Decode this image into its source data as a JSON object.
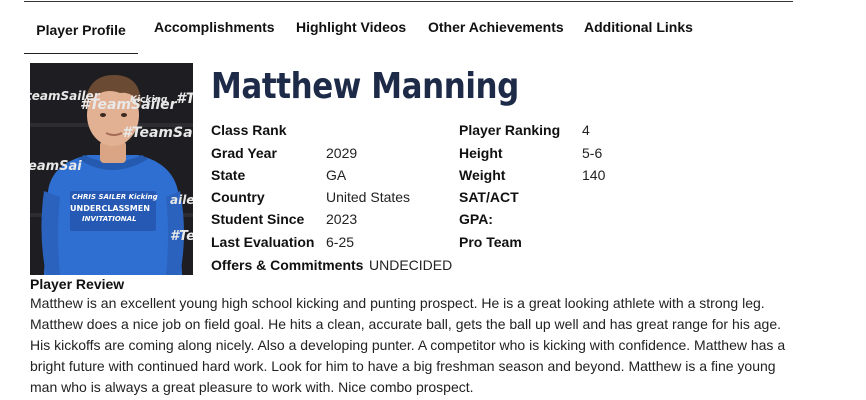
{
  "tabs": {
    "profile": "Player Profile",
    "accomplishments": "Accomplishments",
    "videos": "Highlight Videos",
    "other": "Other Achievements",
    "links": "Additional Links"
  },
  "player": {
    "name": "Matthew Manning"
  },
  "photo": {
    "backdrop_text": [
      "#TeamSailer",
      "teamSailer",
      "Kicking",
      "#TeamSailer",
      "eamSai",
      "ailer",
      "#Te",
      "#T"
    ],
    "shirt_lines": [
      "CHRIS SAILER Kicking",
      "UNDERCLASSMEN",
      "INVITATIONAL"
    ]
  },
  "left_fields": [
    {
      "label": "Class Rank",
      "value": ""
    },
    {
      "label": "Grad Year",
      "value": "2029"
    },
    {
      "label": "State",
      "value": "GA"
    },
    {
      "label": "Country",
      "value": "United States"
    },
    {
      "label": "Student Since",
      "value": "2023"
    },
    {
      "label": "Last Evaluation",
      "value": "6-25"
    },
    {
      "label": "Offers & Commitments",
      "value": "UNDECIDED"
    }
  ],
  "right_fields": [
    {
      "label": "Player Ranking",
      "value": "4"
    },
    {
      "label": "Height",
      "value": "5-6"
    },
    {
      "label": "Weight",
      "value": "140"
    },
    {
      "label": "SAT/ACT",
      "value": ""
    },
    {
      "label": "GPA:",
      "value": ""
    },
    {
      "label": "Pro Team",
      "value": ""
    }
  ],
  "review": {
    "title": "Player Review",
    "text": "Matthew is an excellent young high school kicking and punting prospect. He is a great looking athlete with a strong leg. Matthew does a nice job on field goal. He hits a clean, accurate ball, gets the ball up well and has great range for his age. His kickoffs are coming along nicely. Also a developing punter. A competitor who is kicking with confidence. Matthew has a bright future with continued hard work. Look for him to have a big freshman season and beyond. Matthew is a fine young man who is always a great pleasure to work with. Nice combo prospect."
  }
}
